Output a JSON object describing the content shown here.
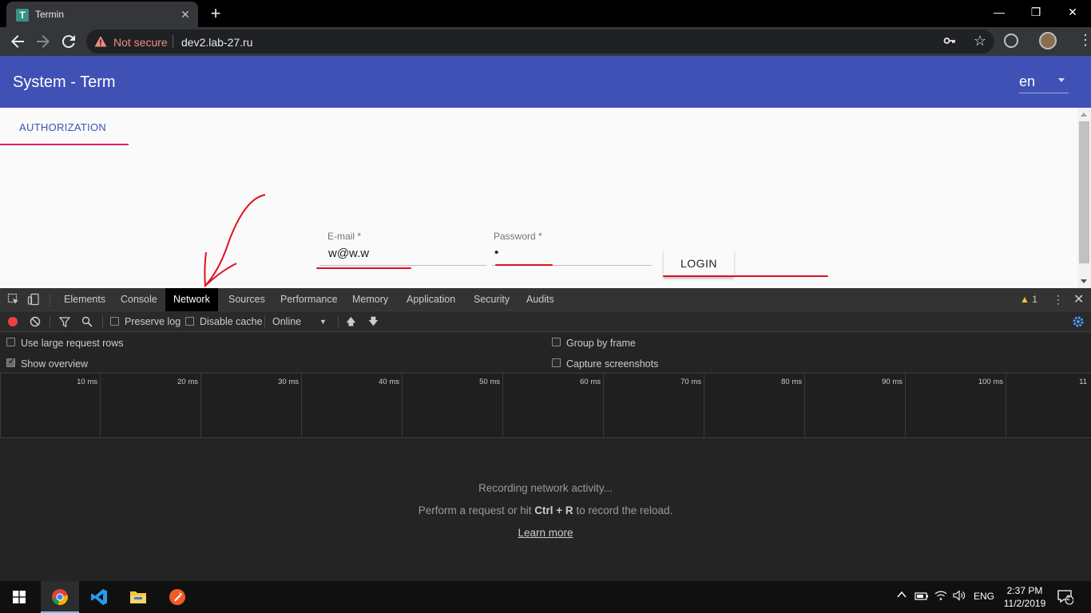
{
  "browser": {
    "tab_title": "Termin",
    "tab_favicon_letter": "T",
    "close_tab_glyph": "✕",
    "new_tab_glyph": "+",
    "security_label": "Not secure",
    "url": "dev2.lab-27.ru",
    "window_buttons": [
      "—",
      "❐",
      "✕"
    ]
  },
  "app": {
    "title": "System - Term",
    "language": "en",
    "tab_label": "AUTHORIZATION",
    "email": {
      "label": "E-mail *",
      "value": "w@w.w"
    },
    "password": {
      "label": "Password *",
      "value": "•"
    },
    "login_label": "LOGIN",
    "colors": {
      "primary": "#3f51b5",
      "tab_indicator": "#e91e63",
      "annotation": "#e0101e"
    }
  },
  "devtools": {
    "tabs": [
      "Elements",
      "Console",
      "Network",
      "Sources",
      "Performance",
      "Memory",
      "Application",
      "Security",
      "Audits"
    ],
    "active_tab": "Network",
    "warning_count": "1",
    "toolbar": {
      "preserve_log": "Preserve log",
      "disable_cache": "Disable cache",
      "throttle": "Online"
    },
    "settings": {
      "large_rows": "Use large request rows",
      "show_overview": "Show overview",
      "group_by_frame": "Group by frame",
      "capture_screenshots": "Capture screenshots"
    },
    "overview_ticks": [
      "10 ms",
      "20 ms",
      "30 ms",
      "40 ms",
      "50 ms",
      "60 ms",
      "70 ms",
      "80 ms",
      "90 ms",
      "100 ms",
      "11"
    ],
    "empty": {
      "line1": "Recording network activity...",
      "line2_prefix": "Perform a request or hit",
      "line2_keys": "Ctrl + R",
      "line2_suffix": "to record the reload.",
      "learn_more": "Learn more"
    }
  },
  "taskbar": {
    "apps": [
      "chrome-icon",
      "vscode-icon",
      "file-explorer-icon",
      "postman-icon"
    ],
    "language": "ENG",
    "time": "2:37 PM",
    "date": "11/2/2019",
    "notification_count": "2"
  }
}
